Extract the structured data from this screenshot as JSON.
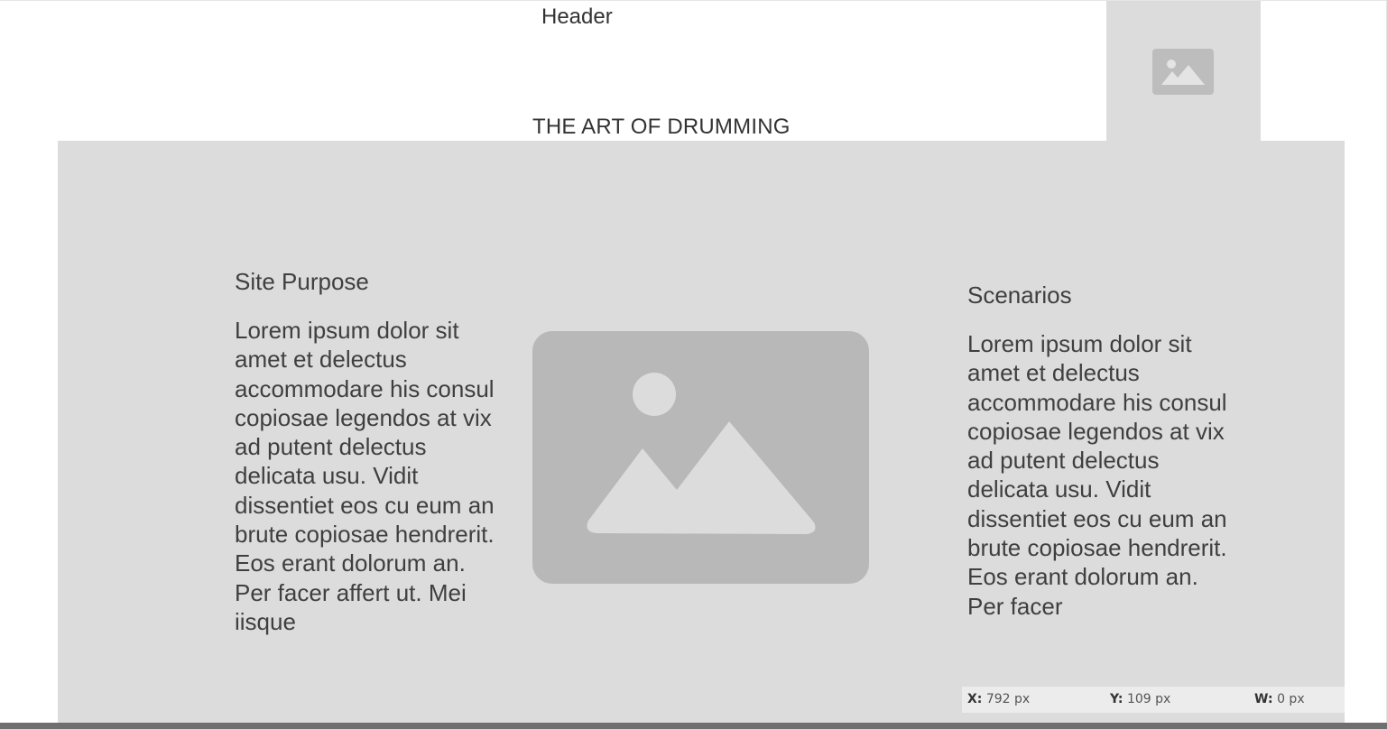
{
  "header": {
    "text": "Header"
  },
  "logo": {
    "icon": "image-placeholder-icon"
  },
  "title": "THE ART OF DRUMMING",
  "left_column": {
    "heading": "Site Purpose",
    "body": "Lorem ipsum dolor sit amet et delectus accommodare his consul copiosae legendos at vix ad putent delectus delicata usu. Vidit dissentiet eos cu eum an brute copiosae hendrerit. Eos erant dolorum an. Per facer affert ut. Mei iisque"
  },
  "center_image": {
    "icon": "image-placeholder-icon"
  },
  "right_column": {
    "heading": "Scenarios",
    "body": "Lorem ipsum dolor sit amet et delectus accommodare his consul copiosae legendos at vix ad putent delectus delicata usu. Vidit dissentiet eos cu eum an brute copiosae hendrerit. Eos erant dolorum an. Per facer"
  },
  "status_bar": {
    "x_label": "X:",
    "x_value": "792 px",
    "y_label": "Y:",
    "y_value": "109 px",
    "w_label": "W:",
    "w_value": "0 px"
  },
  "colors": {
    "panel": "#dcdcdc",
    "placeholder": "#b8b8b8",
    "text": "#3f3f3f"
  }
}
